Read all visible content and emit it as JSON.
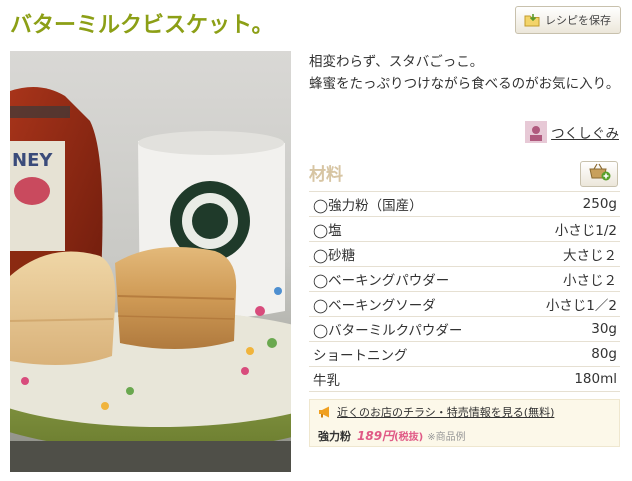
{
  "recipe": {
    "title": "バターミルクビスケット。",
    "save_button": "レシピを保存",
    "description": "相変わらず、スタバごっこ。\n蜂蜜をたっぷりつけながら食べるのがお気に入り。",
    "author": "つくしぐみ"
  },
  "ingredients": {
    "heading": "材料",
    "items": [
      {
        "name": "◯強力粉（国産）",
        "qty": "250g"
      },
      {
        "name": "◯塩",
        "qty": "小さじ1/2"
      },
      {
        "name": "◯砂糖",
        "qty": "大さじ２"
      },
      {
        "name": "◯ベーキングパウダー",
        "qty": "小さじ２"
      },
      {
        "name": "◯ベーキングソーダ",
        "qty": "小さじ1／2"
      },
      {
        "name": "◯バターミルクパウダー",
        "qty": "30g"
      },
      {
        "name": "ショートニング",
        "qty": "80g"
      },
      {
        "name": "牛乳",
        "qty": "180ml"
      }
    ]
  },
  "ad": {
    "link_text": "近くのお店のチラシ・特売情報を見る(無料)",
    "item": "強力粉",
    "price": "189円",
    "tax": "(税抜)",
    "note": "※商品例"
  },
  "colors": {
    "title": "#8c9f16",
    "heading": "#d7c5a3",
    "price": "#e05a86"
  },
  "icons": {
    "save": "folder-save-icon",
    "author": "avatar-icon",
    "basket": "basket-add-icon",
    "ad": "megaphone-icon"
  }
}
